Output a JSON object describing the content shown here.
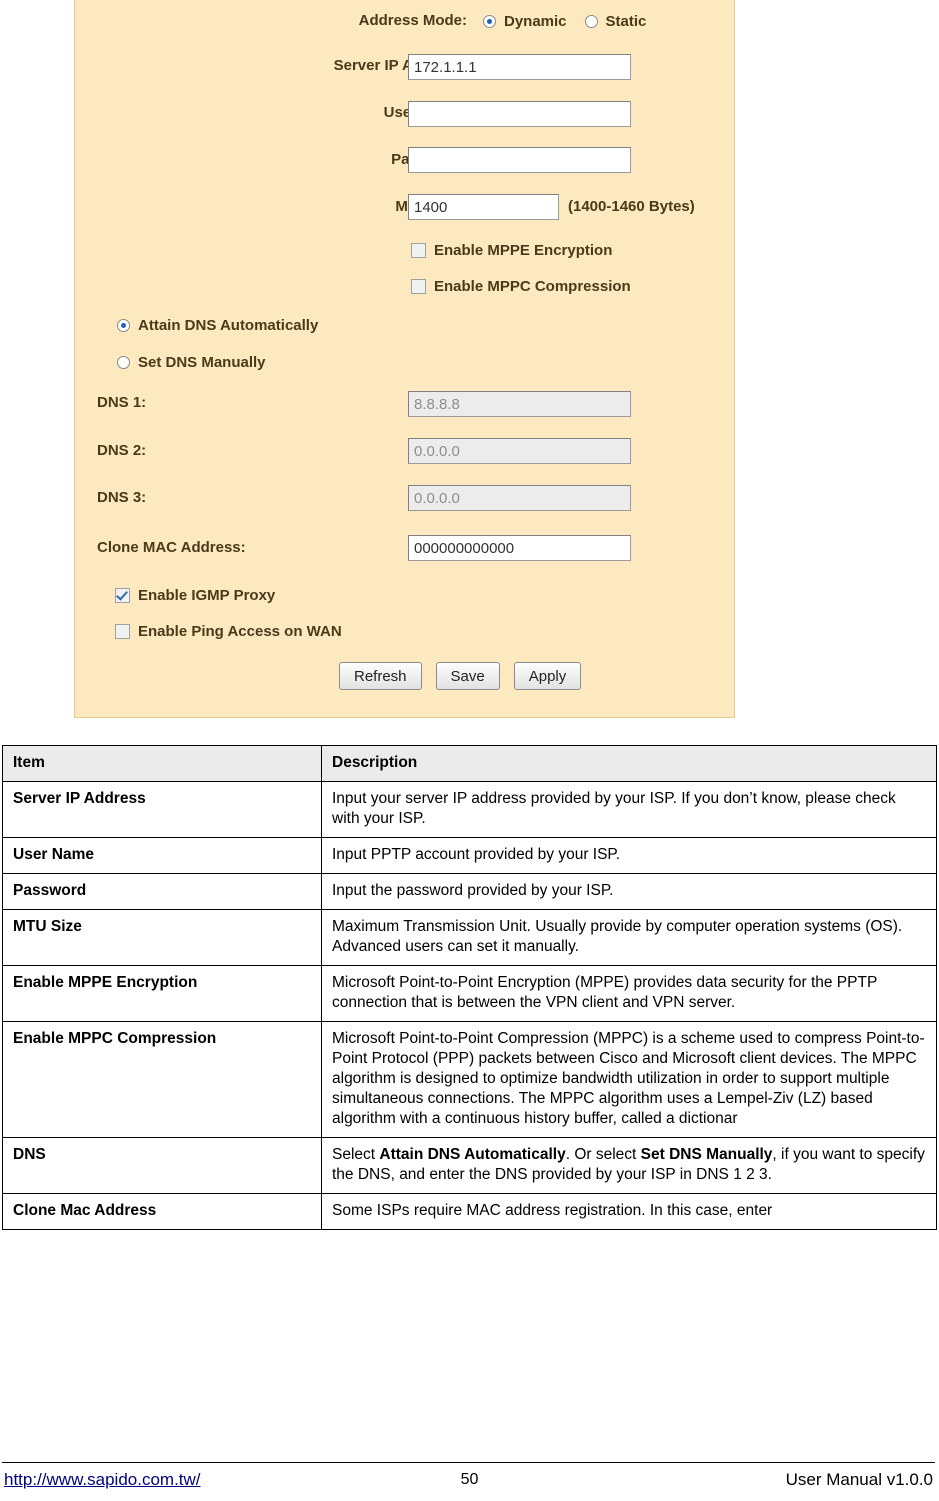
{
  "panel": {
    "address_mode": {
      "label": "Address Mode:",
      "options": [
        {
          "label": "Dynamic",
          "selected": true
        },
        {
          "label": "Static",
          "selected": false
        }
      ]
    },
    "server_ip": {
      "label": "Server IP Address:",
      "value": "172.1.1.1"
    },
    "user_name": {
      "label": "User Name:",
      "value": ""
    },
    "password": {
      "label": "Password:",
      "value": ""
    },
    "mtu": {
      "label": "MTU Size:",
      "value": "1400",
      "hint": "(1400-1460 Bytes)"
    },
    "mppe": {
      "label": "Enable MPPE Encryption",
      "checked": false
    },
    "mppc": {
      "label": "Enable MPPC Compression",
      "checked": false
    },
    "dns_mode": {
      "auto": {
        "label": "Attain DNS Automatically",
        "selected": true
      },
      "manual": {
        "label": "Set DNS Manually",
        "selected": false
      }
    },
    "dns1": {
      "label": "DNS 1:",
      "value": "8.8.8.8"
    },
    "dns2": {
      "label": "DNS 2:",
      "value": "0.0.0.0"
    },
    "dns3": {
      "label": "DNS 3:",
      "value": "0.0.0.0"
    },
    "clone_mac": {
      "label": "Clone MAC Address:",
      "value": "000000000000"
    },
    "igmp": {
      "label": "Enable IGMP Proxy",
      "checked": true
    },
    "ping": {
      "label": "Enable Ping Access on WAN",
      "checked": false
    },
    "buttons": {
      "refresh": "Refresh",
      "save": "Save",
      "apply": "Apply"
    }
  },
  "table": {
    "headers": {
      "item": "Item",
      "description": "Description"
    },
    "rows": [
      {
        "item": "Server IP Address",
        "desc": "Input your server IP address provided by your ISP.    If you don’t know, please check with your ISP."
      },
      {
        "item": "User Name",
        "desc": "Input PPTP account provided by your ISP."
      },
      {
        "item": "Password",
        "desc": "Input the password provided by your ISP."
      },
      {
        "item": "MTU Size",
        "desc": "Maximum Transmission Unit. Usually provide by computer operation systems (OS). Advanced users can set it manually."
      },
      {
        "item": "Enable MPPE Encryption",
        "desc": "Microsoft Point-to-Point Encryption (MPPE) provides data security for the PPTP connection that is between the VPN client and VPN server."
      },
      {
        "item": "Enable MPPC Compression",
        "desc": "Microsoft Point-to-Point Compression (MPPC) is a scheme used to compress Point-to-Point Protocol (PPP) packets between Cisco and Microsoft client devices. The MPPC algorithm is designed to optimize bandwidth utilization in order to support multiple simultaneous connections. The MPPC algorithm uses a Lempel-Ziv (LZ) based algorithm with a continuous history buffer, called a dictionar"
      },
      {
        "item": "DNS",
        "desc_parts": [
          {
            "text": "Select ",
            "bold": false
          },
          {
            "text": "Attain DNS Automatically",
            "bold": true
          },
          {
            "text": ". Or select ",
            "bold": false
          },
          {
            "text": "Set DNS Manually",
            "bold": true
          },
          {
            "text": ", if you want to specify the DNS, and enter the DNS provided by your ISP in DNS 1 2 3.",
            "bold": false
          }
        ]
      },
      {
        "item": "Clone Mac Address",
        "desc": "Some ISPs require MAC address registration. In this case, enter"
      }
    ]
  },
  "footer": {
    "url": "http://www.sapido.com.tw/",
    "page": "50",
    "manual": "User  Manual  v1.0.0"
  }
}
